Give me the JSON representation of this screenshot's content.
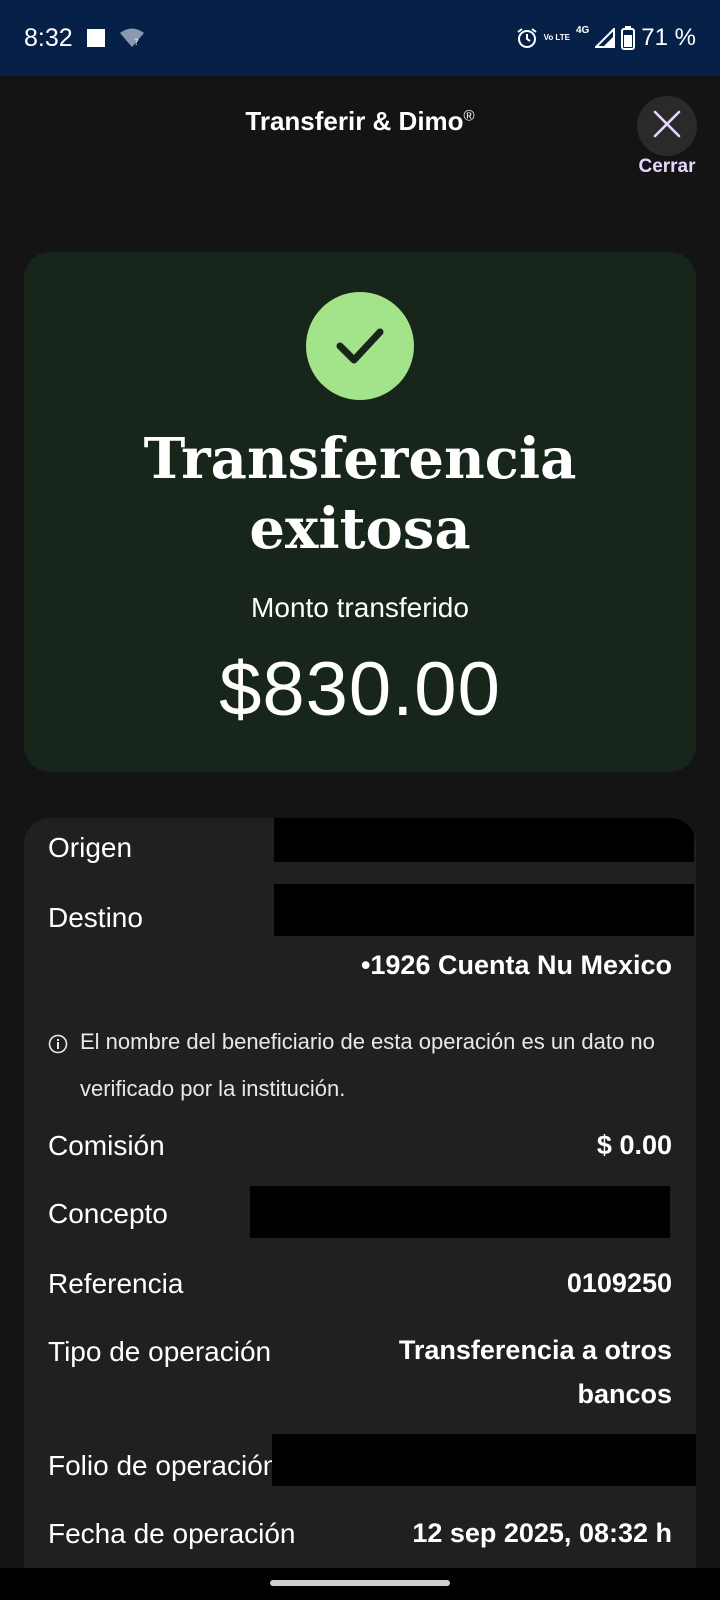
{
  "status_bar": {
    "time": "8:32",
    "battery": "71 %",
    "network": "4G",
    "volte": "Vo LTE"
  },
  "header": {
    "title": "Transferir & Dimo",
    "title_mark": "®",
    "close_label": "Cerrar"
  },
  "success": {
    "title_line1": "Transferencia",
    "title_line2": "exitosa",
    "amount_label": "Monto transferido",
    "amount_value": "$830.00",
    "accent_color": "#a3e48b"
  },
  "details": {
    "origen_label": "Origen",
    "destino_label": "Destino",
    "destino_account": "•1926 Cuenta Nu Mexico",
    "info_note": "El nombre del beneficiario de esta operación es un dato no verificado por la institución.",
    "comision_label": "Comisión",
    "comision_value": "$ 0.00",
    "concepto_label": "Concepto",
    "referencia_label": "Referencia",
    "referencia_value": "0109250",
    "tipo_label": "Tipo de operación",
    "tipo_value_line1": "Transferencia a otros",
    "tipo_value_line2": "bancos",
    "folio_label": "Folio de operación",
    "fecha_label": "Fecha de operación",
    "fecha_value": "12 sep 2025, 08:32 h"
  }
}
